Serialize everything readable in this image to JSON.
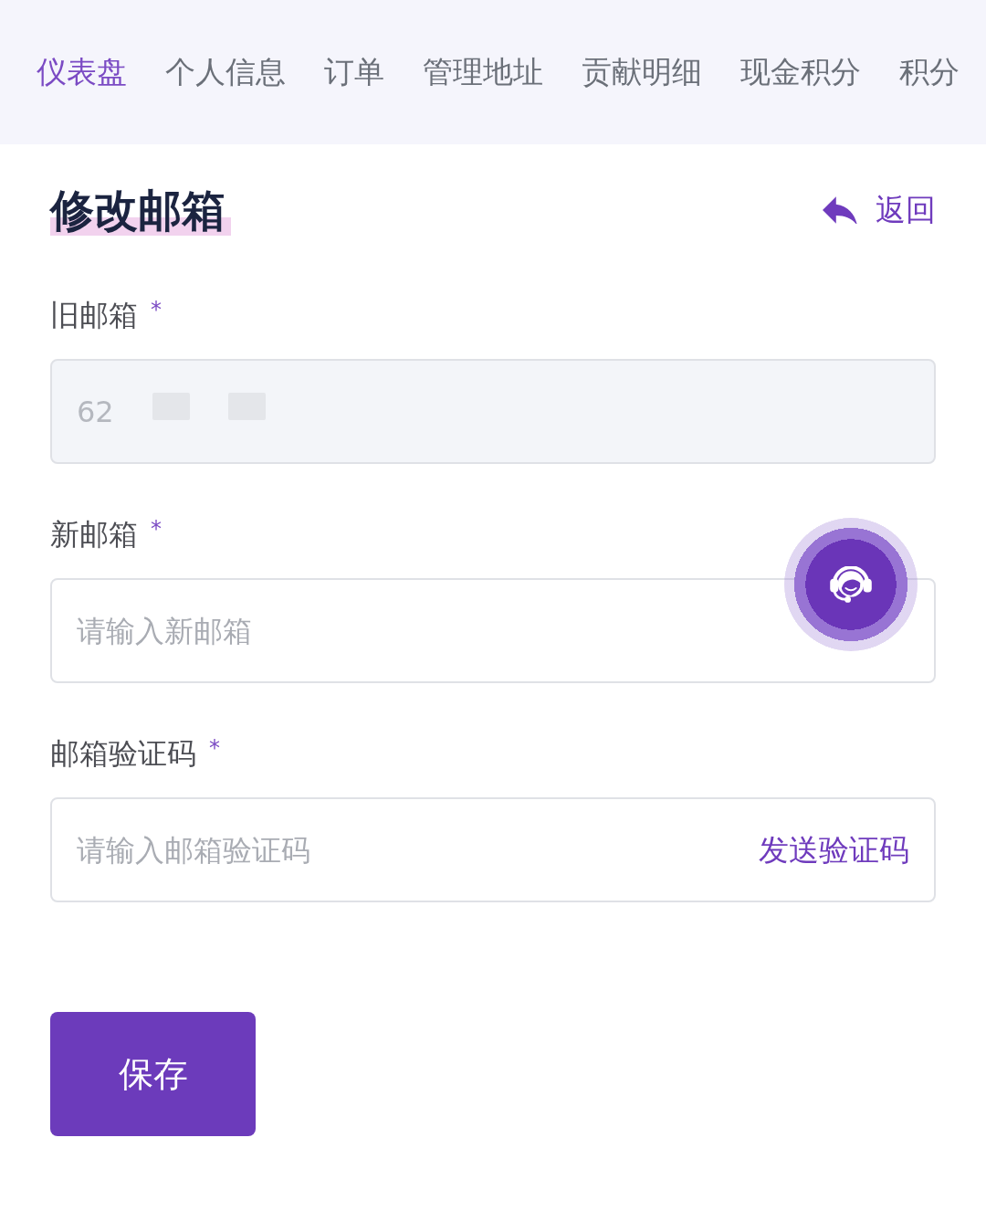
{
  "nav": {
    "tabs": [
      {
        "label": "仪表盘",
        "selected": true
      },
      {
        "label": "个人信息",
        "selected": false
      },
      {
        "label": "订单",
        "selected": false
      },
      {
        "label": "管理地址",
        "selected": false
      },
      {
        "label": "贡献明细",
        "selected": false
      },
      {
        "label": "现金积分",
        "selected": false
      },
      {
        "label": "积分",
        "selected": false
      }
    ]
  },
  "header": {
    "title": "修改邮箱",
    "back_link": "返回"
  },
  "form": {
    "fields": [
      {
        "kind": "readonly",
        "label": "旧邮箱",
        "required_mark": "*",
        "value": "62",
        "redacted": true
      },
      {
        "kind": "input",
        "label": "新邮箱",
        "required_mark": "*",
        "placeholder": "请输入新邮箱"
      },
      {
        "kind": "code",
        "label": "邮箱验证码",
        "required_mark": "*",
        "placeholder": "请输入邮箱验证码",
        "action": "发送验证码"
      }
    ]
  },
  "save_button": "保存"
}
